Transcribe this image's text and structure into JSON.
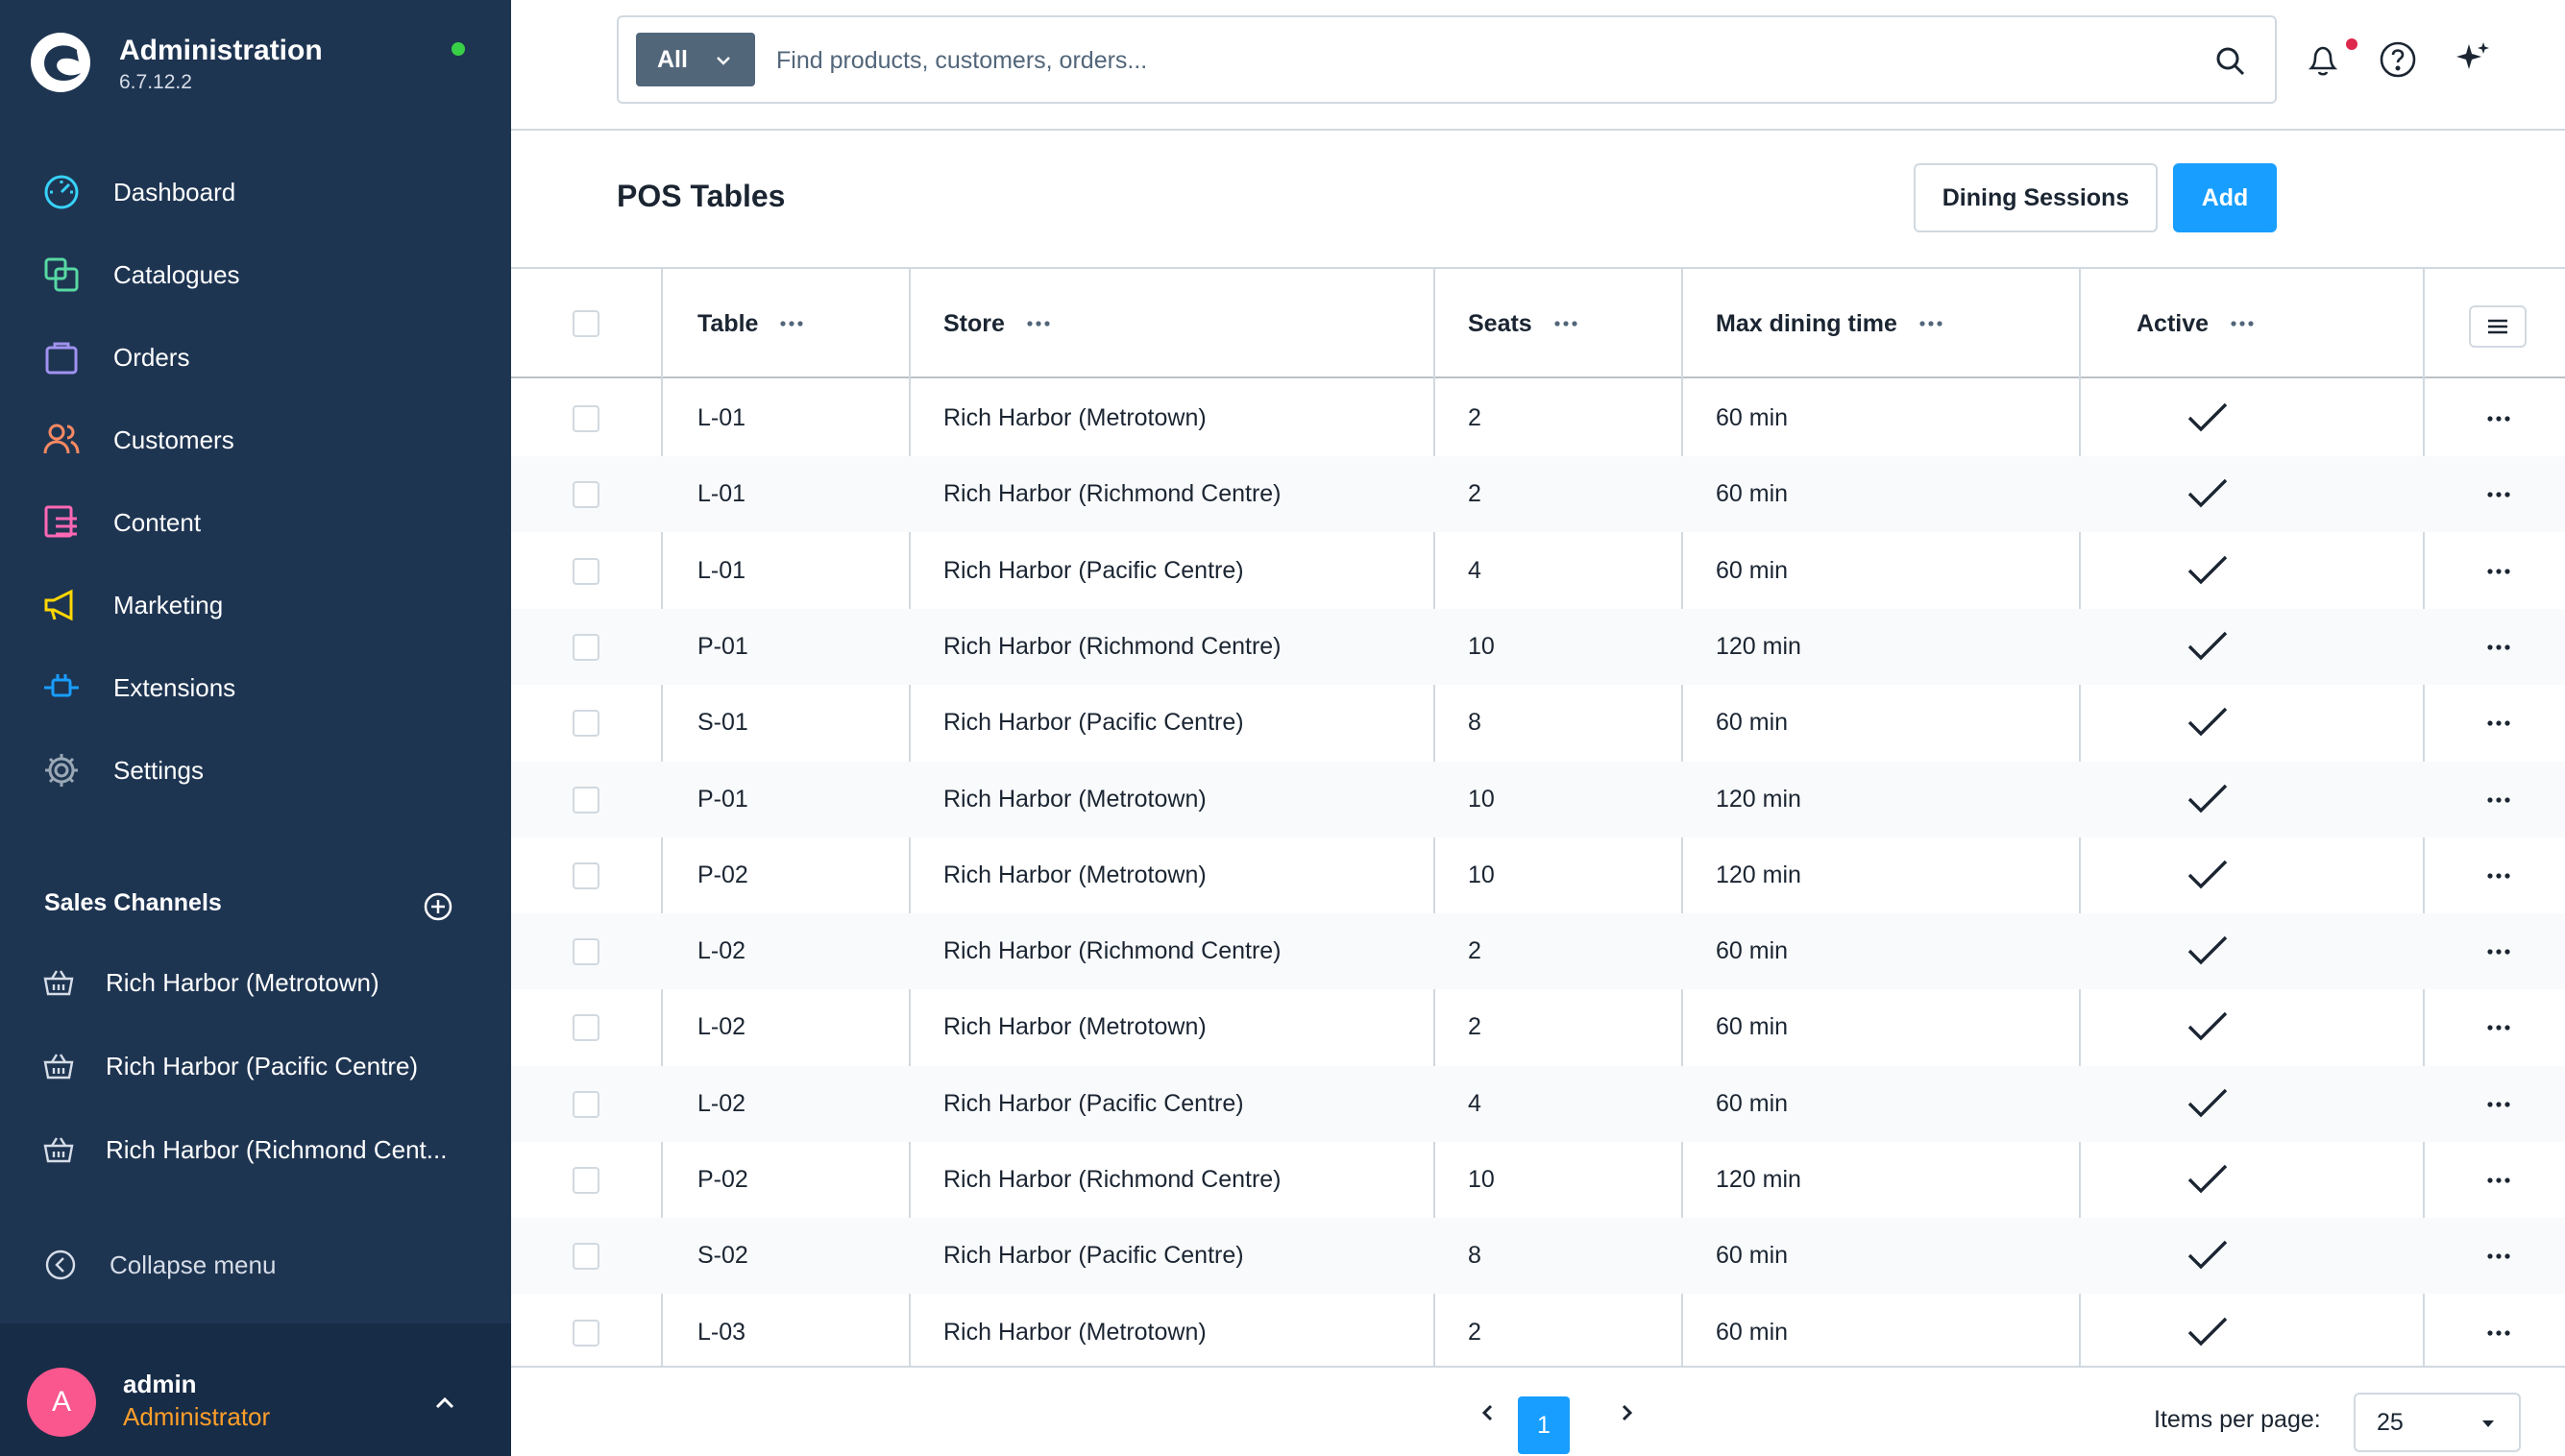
{
  "app": {
    "title": "Administration",
    "version": "6.7.12.2"
  },
  "sidebar": {
    "items": [
      {
        "label": "Dashboard",
        "icon": "dashboard-icon",
        "color": "#37d2f8"
      },
      {
        "label": "Catalogues",
        "icon": "catalogues-icon",
        "color": "#57d9a3"
      },
      {
        "label": "Orders",
        "icon": "orders-icon",
        "color": "#a092f0"
      },
      {
        "label": "Customers",
        "icon": "customers-icon",
        "color": "#f88962"
      },
      {
        "label": "Content",
        "icon": "content-icon",
        "color": "#ff68b4"
      },
      {
        "label": "Marketing",
        "icon": "marketing-icon",
        "color": "#ffd700"
      },
      {
        "label": "Extensions",
        "icon": "extensions-icon",
        "color": "#189eff"
      },
      {
        "label": "Settings",
        "icon": "settings-icon",
        "color": "#9aa8b5"
      }
    ],
    "sales_channels_title": "Sales Channels",
    "sales_channels": [
      {
        "label": "Rich Harbor (Metrotown)"
      },
      {
        "label": "Rich Harbor (Pacific Centre)"
      },
      {
        "label": "Rich Harbor (Richmond Cent..."
      }
    ],
    "collapse_label": "Collapse menu",
    "user": {
      "initial": "A",
      "name": "admin",
      "role": "Administrator"
    }
  },
  "search": {
    "type_label": "All",
    "placeholder": "Find products, customers, orders..."
  },
  "page": {
    "title": "POS Tables",
    "secondary_button": "Dining Sessions",
    "primary_button": "Add"
  },
  "grid": {
    "columns": {
      "table": "Table",
      "store": "Store",
      "seats": "Seats",
      "max_dining_time": "Max dining time",
      "active": "Active"
    },
    "rows": [
      {
        "table": "L-01",
        "store": "Rich Harbor (Metrotown)",
        "seats": "2",
        "time": "60 min",
        "active": true
      },
      {
        "table": "L-01",
        "store": "Rich Harbor (Richmond Centre)",
        "seats": "2",
        "time": "60 min",
        "active": true
      },
      {
        "table": "L-01",
        "store": "Rich Harbor (Pacific Centre)",
        "seats": "4",
        "time": "60 min",
        "active": true
      },
      {
        "table": "P-01",
        "store": "Rich Harbor (Richmond Centre)",
        "seats": "10",
        "time": "120 min",
        "active": true
      },
      {
        "table": "S-01",
        "store": "Rich Harbor (Pacific Centre)",
        "seats": "8",
        "time": "60 min",
        "active": true
      },
      {
        "table": "P-01",
        "store": "Rich Harbor (Metrotown)",
        "seats": "10",
        "time": "120 min",
        "active": true
      },
      {
        "table": "P-02",
        "store": "Rich Harbor (Metrotown)",
        "seats": "10",
        "time": "120 min",
        "active": true
      },
      {
        "table": "L-02",
        "store": "Rich Harbor (Richmond Centre)",
        "seats": "2",
        "time": "60 min",
        "active": true
      },
      {
        "table": "L-02",
        "store": "Rich Harbor (Metrotown)",
        "seats": "2",
        "time": "60 min",
        "active": true
      },
      {
        "table": "L-02",
        "store": "Rich Harbor (Pacific Centre)",
        "seats": "4",
        "time": "60 min",
        "active": true
      },
      {
        "table": "P-02",
        "store": "Rich Harbor (Richmond Centre)",
        "seats": "10",
        "time": "120 min",
        "active": true
      },
      {
        "table": "S-02",
        "store": "Rich Harbor (Pacific Centre)",
        "seats": "8",
        "time": "60 min",
        "active": true
      },
      {
        "table": "L-03",
        "store": "Rich Harbor (Metrotown)",
        "seats": "2",
        "time": "60 min",
        "active": true
      }
    ]
  },
  "pagination": {
    "current_page": "1",
    "items_per_page_label": "Items per page:",
    "items_per_page": "25"
  },
  "colors": {
    "sidebar_bg": "#1e3552",
    "primary": "#189eff",
    "status_online": "#37d046",
    "avatar": "#f9578e",
    "role": "#ff9f2a"
  }
}
